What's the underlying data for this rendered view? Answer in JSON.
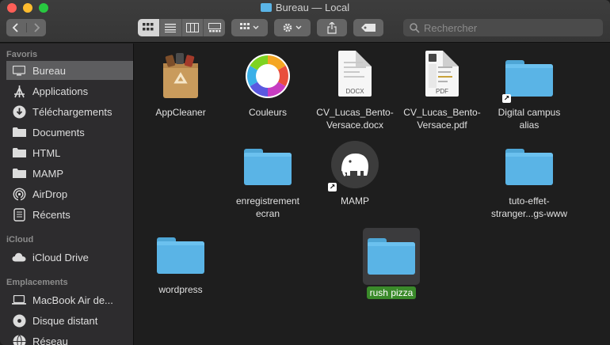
{
  "window": {
    "title": "Bureau — Local"
  },
  "toolbar": {
    "back_icon": "chevron-left-icon",
    "forward_icon": "chevron-right-icon",
    "views": [
      "icon-view",
      "list-view",
      "column-view",
      "gallery-view"
    ],
    "active_view": "icon-view",
    "search": {
      "placeholder": "Rechercher",
      "value": ""
    }
  },
  "sidebar": {
    "sections": [
      {
        "title": "Favoris",
        "items": [
          {
            "label": "Bureau",
            "icon": "desktop-icon",
            "selected": true
          },
          {
            "label": "Applications",
            "icon": "applications-icon"
          },
          {
            "label": "Téléchargements",
            "icon": "download-icon"
          },
          {
            "label": "Documents",
            "icon": "folder-icon"
          },
          {
            "label": "HTML",
            "icon": "folder-icon"
          },
          {
            "label": "MAMP",
            "icon": "folder-icon"
          },
          {
            "label": "AirDrop",
            "icon": "airdrop-icon"
          },
          {
            "label": "Récents",
            "icon": "recents-icon"
          }
        ]
      },
      {
        "title": "iCloud",
        "items": [
          {
            "label": "iCloud Drive",
            "icon": "cloud-icon"
          }
        ]
      },
      {
        "title": "Emplacements",
        "items": [
          {
            "label": "MacBook Air de...",
            "icon": "laptop-icon"
          },
          {
            "label": "Disque distant",
            "icon": "disc-icon"
          },
          {
            "label": "Réseau",
            "icon": "network-icon"
          }
        ]
      }
    ]
  },
  "files": [
    {
      "name": "AppCleaner",
      "kind": "app-icon"
    },
    {
      "name": "Couleurs",
      "kind": "color-wheel-icon"
    },
    {
      "name": "CV_Lucas_Bento-Versace.docx",
      "display": "CV_Lucas_Bento-\nVersace.docx",
      "kind": "docx-icon",
      "badge": "DOCX"
    },
    {
      "name": "CV_Lucas_Bento-Versace.pdf",
      "display": "CV_Lucas_Bento-\nVersace.pdf",
      "kind": "pdf-icon",
      "badge": "PDF"
    },
    {
      "name": "Digital campus alias",
      "display": "Digital campus\nalias",
      "kind": "folder-alias-icon"
    },
    {
      "name": "enregistrement ecran",
      "display": "enregistrement\necran",
      "kind": "folder-icon"
    },
    {
      "name": "MAMP",
      "kind": "mamp-alias-icon"
    },
    {
      "name": "tuto-effet-stranger...gs-www",
      "display": "tuto-effet-\nstranger...gs-www",
      "kind": "folder-icon"
    },
    {
      "name": "wordpress",
      "kind": "folder-icon"
    },
    {
      "name": "rush pizza",
      "kind": "folder-icon",
      "selected": true
    }
  ],
  "colors": {
    "folder_blue": "#5ab4e6",
    "selection_green": "#3a8a2a",
    "sidebar_bg": "#2d2c2e",
    "content_bg": "#1e1e1e"
  }
}
